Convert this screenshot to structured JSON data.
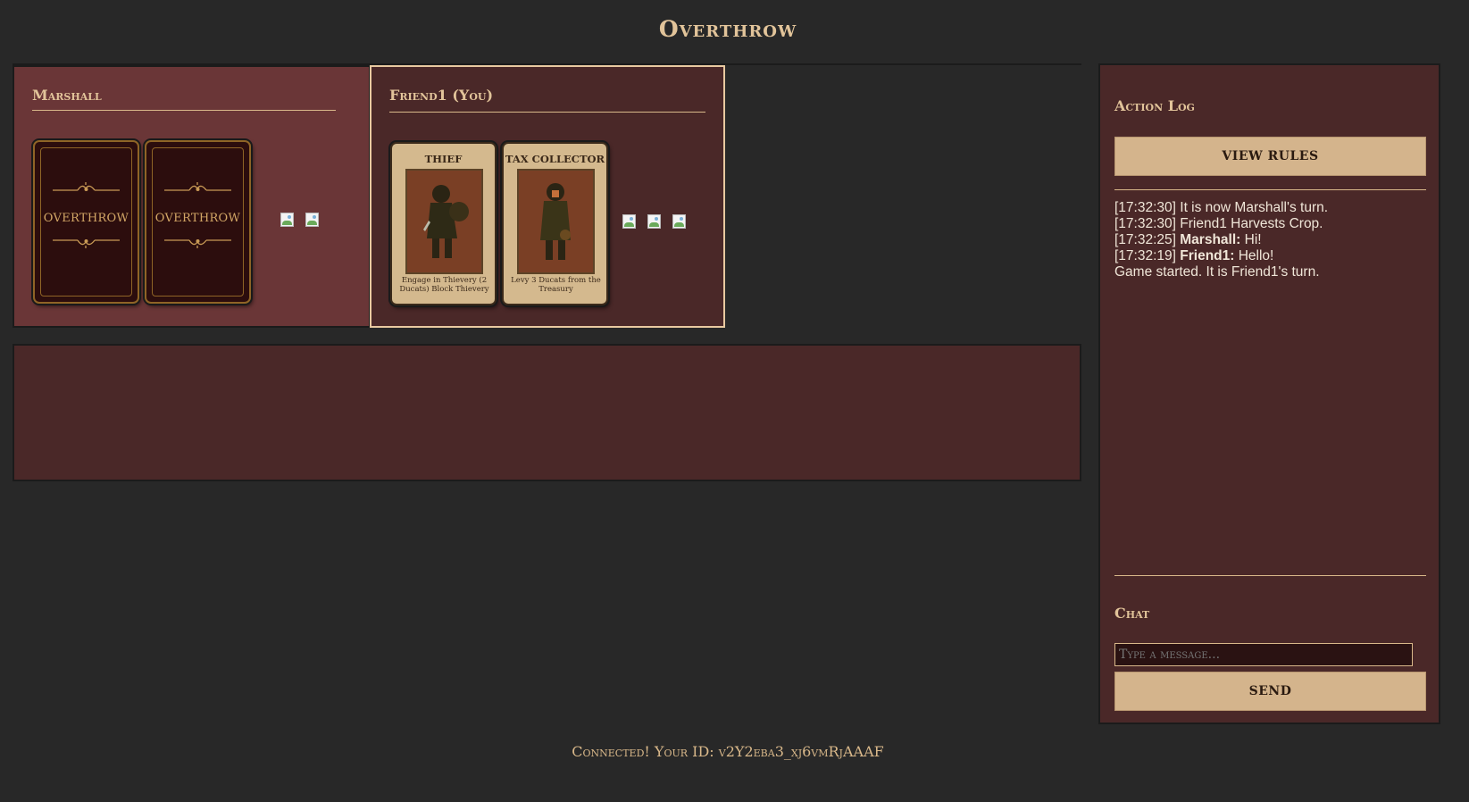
{
  "title": "Overthrow",
  "players": [
    {
      "name": "Marshall",
      "cards": [
        {
          "face": "back",
          "label": "OVERTHROW"
        },
        {
          "face": "back",
          "label": "OVERTHROW"
        }
      ]
    },
    {
      "name": "Friend1 (You)",
      "cards": [
        {
          "face": "up",
          "name": "THIEF",
          "ability": "Engage in Thievery (2 Ducats) Block Thievery"
        },
        {
          "face": "up",
          "name": "TAX COLLECTOR",
          "ability": "Levy 3 Ducats from the Treasury"
        }
      ]
    }
  ],
  "sidebar": {
    "action_log_heading": "Action Log",
    "view_rules_label": "VIEW RULES",
    "log": [
      {
        "time": "[17:32:30]",
        "who": "",
        "text": "It is now Marshall's turn."
      },
      {
        "time": "[17:32:30]",
        "who": "",
        "text": "Friend1 Harvests Crop."
      },
      {
        "time": "[17:32:25]",
        "who": "Marshall:",
        "text": "Hi!"
      },
      {
        "time": "[17:32:19]",
        "who": "Friend1:",
        "text": "Hello!"
      },
      {
        "time": "",
        "who": "",
        "text": "Game started. It is Friend1's turn."
      }
    ],
    "chat_heading": "Chat",
    "chat_placeholder": "Type a message...",
    "send_label": "SEND"
  },
  "status": "Connected! Your ID: v2Y2eba3_xj6vmRjAAAF",
  "colors": {
    "background": "#282828",
    "opponent_panel": "#6a3637",
    "panel": "#4a2828",
    "accent": "#d4b48c"
  }
}
